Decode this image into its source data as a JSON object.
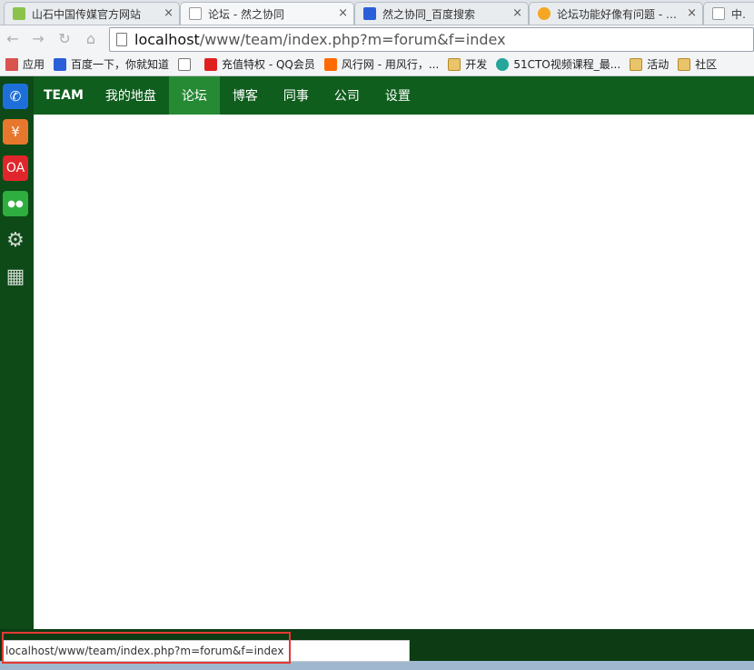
{
  "browser": {
    "tabs": [
      {
        "label": "山石中国传媒官方网站",
        "close": "×",
        "color": "#8bc34a"
      },
      {
        "label": "论坛 - 然之协同",
        "close": "×",
        "color": "#ffffff",
        "active": true
      },
      {
        "label": "然之协同_百度搜索",
        "close": "×",
        "color": "#2b5fd9"
      },
      {
        "label": "论坛功能好像有问题 - 建议",
        "close": "×",
        "color": "#f5a623"
      },
      {
        "label": "中云-",
        "close": "",
        "color": "#ffffff"
      }
    ],
    "url_host": "localhost",
    "url_rest": "/www/team/index.php?m=forum&f=index",
    "bookmarks": [
      {
        "label": "应用",
        "icon": "apps-icon",
        "color": "#d9534f"
      },
      {
        "label": "百度一下，你就知道",
        "icon": "baidu-icon",
        "color": "#2b5fd9"
      },
      {
        "label": "",
        "icon": "page-icon",
        "color": "#ffffff"
      },
      {
        "label": "充值特权 - QQ会员",
        "icon": "qq-icon",
        "color": "#e02020"
      },
      {
        "label": "风行网 - 用风行，...",
        "icon": "funshion-icon",
        "color": "#ff6a00"
      },
      {
        "label": "开发",
        "icon": "folder-icon",
        "color": "#e9c46a"
      },
      {
        "label": "51CTO视频课程_最...",
        "icon": "play-icon",
        "color": "#26a69a"
      },
      {
        "label": "活动",
        "icon": "folder-icon",
        "color": "#e9c46a"
      },
      {
        "label": "社区",
        "icon": "folder-icon",
        "color": "#e9c46a"
      }
    ]
  },
  "app": {
    "brand": "TEAM",
    "nav": [
      "我的地盘",
      "论坛",
      "博客",
      "同事",
      "公司",
      "设置"
    ],
    "active_nav": "论坛",
    "side_icons": [
      {
        "name": "phone-icon",
        "glyph": "✆",
        "bg": "#1e6fd9"
      },
      {
        "name": "yuan-icon",
        "glyph": "¥",
        "bg": "#e8772e"
      },
      {
        "name": "oa-icon",
        "glyph": "OA",
        "bg": "#e0262b"
      },
      {
        "name": "team-icon",
        "glyph": "●●",
        "bg": "#2eae3f"
      },
      {
        "name": "gear-icon",
        "glyph": "⚙",
        "bg": "transparent"
      },
      {
        "name": "grid-icon",
        "glyph": "▦",
        "bg": "transparent"
      }
    ]
  },
  "status_url": "localhost/www/team/index.php?m=forum&f=index",
  "colors": {
    "nav_bg": "#0f5e1e",
    "nav_active": "#268a35",
    "side_bg": "#0d4a17"
  }
}
